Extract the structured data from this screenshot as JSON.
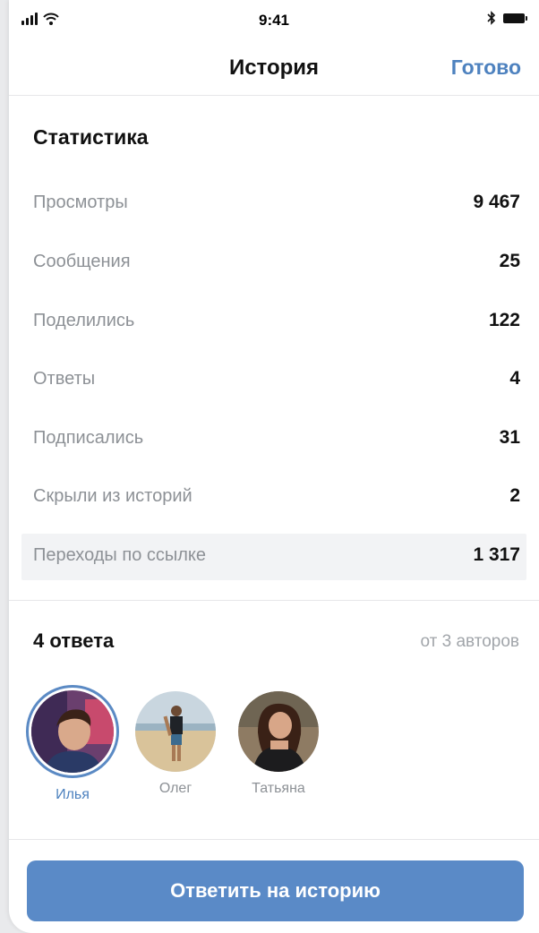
{
  "status_bar": {
    "time": "9:41"
  },
  "nav": {
    "title": "История",
    "done_label": "Готово"
  },
  "stats": {
    "title": "Статистика",
    "rows": [
      {
        "label": "Просмотры",
        "value": "9 467"
      },
      {
        "label": "Сообщения",
        "value": "25"
      },
      {
        "label": "Поделились",
        "value": "122"
      },
      {
        "label": "Ответы",
        "value": "4"
      },
      {
        "label": "Подписались",
        "value": "31"
      },
      {
        "label": "Скрыли из историй",
        "value": "2"
      },
      {
        "label": "Переходы по ссылке",
        "value": "1 317"
      }
    ]
  },
  "replies": {
    "title": "4 ответа",
    "meta": "от 3 авторов",
    "authors": [
      {
        "name": "Илья",
        "selected": true
      },
      {
        "name": "Олег",
        "selected": false
      },
      {
        "name": "Татьяна",
        "selected": false
      }
    ]
  },
  "action": {
    "reply_label": "Ответить на историю"
  },
  "colors": {
    "accent": "#4e82bf",
    "button": "#5a8ac7",
    "muted": "#8d9196"
  }
}
